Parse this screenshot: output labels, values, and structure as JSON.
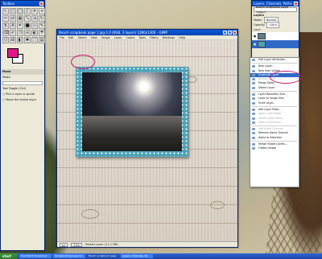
{
  "toolbox": {
    "title": "Toolbox",
    "tools": [
      "↖",
      "□",
      "◯",
      "ʃ",
      "✦",
      "⌖",
      "✂",
      "⇄",
      "▦",
      "⤡",
      "⇲",
      "↻",
      "⇅",
      "A",
      "✒",
      "⬤",
      "▭",
      "✎",
      "⌫",
      "✐",
      "❍",
      "≋",
      "◐",
      "☂",
      "⬡",
      "⊞",
      "◧",
      "✱",
      "⛶",
      "▤"
    ],
    "section_title": "Move",
    "options": [
      "Mode:",
      "Tool Toggle (Ctrl)",
      "Pick a layer or guide",
      "Move the active layer"
    ],
    "fg_color": "#e01888",
    "bg_color": "#ffffff"
  },
  "image_window": {
    "title": "Beach scrapbook page 1.jpg-1.0 (RGB, 3 layers) 1280x1300 – GIMP",
    "menu": [
      "File",
      "Edit",
      "Select",
      "View",
      "Image",
      "Layer",
      "Colors",
      "Tools",
      "Filters",
      "Windows",
      "Help"
    ],
    "status_unit": "px",
    "status_zoom": "25%",
    "status_text": "Pasted Layer (11.2 MB)"
  },
  "layers_window": {
    "title": "Layers, Channels, Paths",
    "image_select": "Beach scrapbook page 1.jpg-1",
    "layers_label": "Layers",
    "mode_label": "Mode:",
    "mode_value": "Normal",
    "opacity_label": "Opacity:",
    "opacity_value": "100.0",
    "lock_label": "Lock:"
  },
  "context_menu": {
    "items": [
      {
        "label": "Edit Layer Attributes...",
        "state": "normal"
      },
      {
        "label": "sep"
      },
      {
        "label": "New Layer...",
        "state": "normal"
      },
      {
        "label": "New from Visible",
        "state": "normal"
      },
      {
        "label": "Duplicate Layer",
        "state": "selected"
      },
      {
        "label": "Anchor Layer",
        "state": "disabled"
      },
      {
        "label": "Merge Down",
        "state": "normal"
      },
      {
        "label": "Delete Layer",
        "state": "normal"
      },
      {
        "label": "sep"
      },
      {
        "label": "Layer Boundary Size...",
        "state": "normal"
      },
      {
        "label": "Layer to Image Size",
        "state": "normal"
      },
      {
        "label": "Scale Layer...",
        "state": "normal"
      },
      {
        "label": "sep"
      },
      {
        "label": "Add Layer Mask...",
        "state": "normal"
      },
      {
        "label": "Apply Layer Mask",
        "state": "disabled"
      },
      {
        "label": "Delete Layer Mask",
        "state": "disabled"
      },
      {
        "label": "Mask to Selection",
        "state": "disabled"
      },
      {
        "label": "sep"
      },
      {
        "label": "Add Alpha Channel",
        "state": "disabled"
      },
      {
        "label": "Remove Alpha Channel",
        "state": "normal"
      },
      {
        "label": "Alpha to Selection",
        "state": "normal"
      },
      {
        "label": "sep"
      },
      {
        "label": "Merge Visible Layers...",
        "state": "normal"
      },
      {
        "label": "Flatten Image",
        "state": "normal"
      }
    ]
  },
  "taskbar": {
    "start": "start",
    "tasks": [
      {
        "label": "Pure Earth Scrapbook",
        "active": false
      },
      {
        "label": "Scrapbooking Goes Int",
        "active": false
      },
      {
        "label": "Beach scrapbook page",
        "active": true
      },
      {
        "label": "Layers, Channels, Pa",
        "active": false
      }
    ]
  }
}
